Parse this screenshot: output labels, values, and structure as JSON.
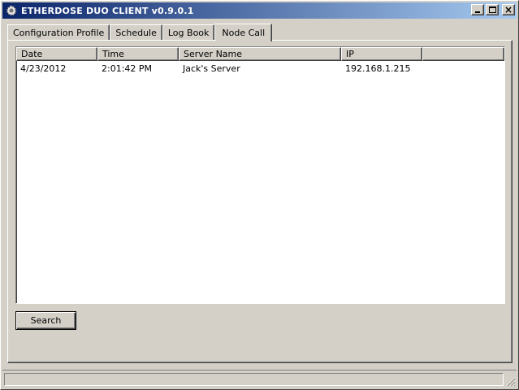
{
  "window": {
    "title": "ETHERDOSE DUO CLIENT v0.9.0.1"
  },
  "tabs": [
    {
      "label": "Configuration Profile",
      "active": false
    },
    {
      "label": "Schedule",
      "active": false
    },
    {
      "label": "Log Book",
      "active": false
    },
    {
      "label": "Node Call",
      "active": true
    }
  ],
  "table": {
    "columns": [
      "Date",
      "Time",
      "Server Name",
      "IP"
    ],
    "rows": [
      {
        "date": "4/23/2012",
        "time": "2:01:42 PM",
        "server": "Jack's Server",
        "ip": "192.168.1.215"
      }
    ]
  },
  "buttons": {
    "search": "Search"
  },
  "icons": {
    "app": "gear-icon",
    "minimize": "minimize-icon",
    "maximize": "maximize-icon",
    "close": "close-icon"
  },
  "colors": {
    "titlebar_start": "#0a246a",
    "titlebar_end": "#a6caf0",
    "face": "#d4d0c8"
  }
}
